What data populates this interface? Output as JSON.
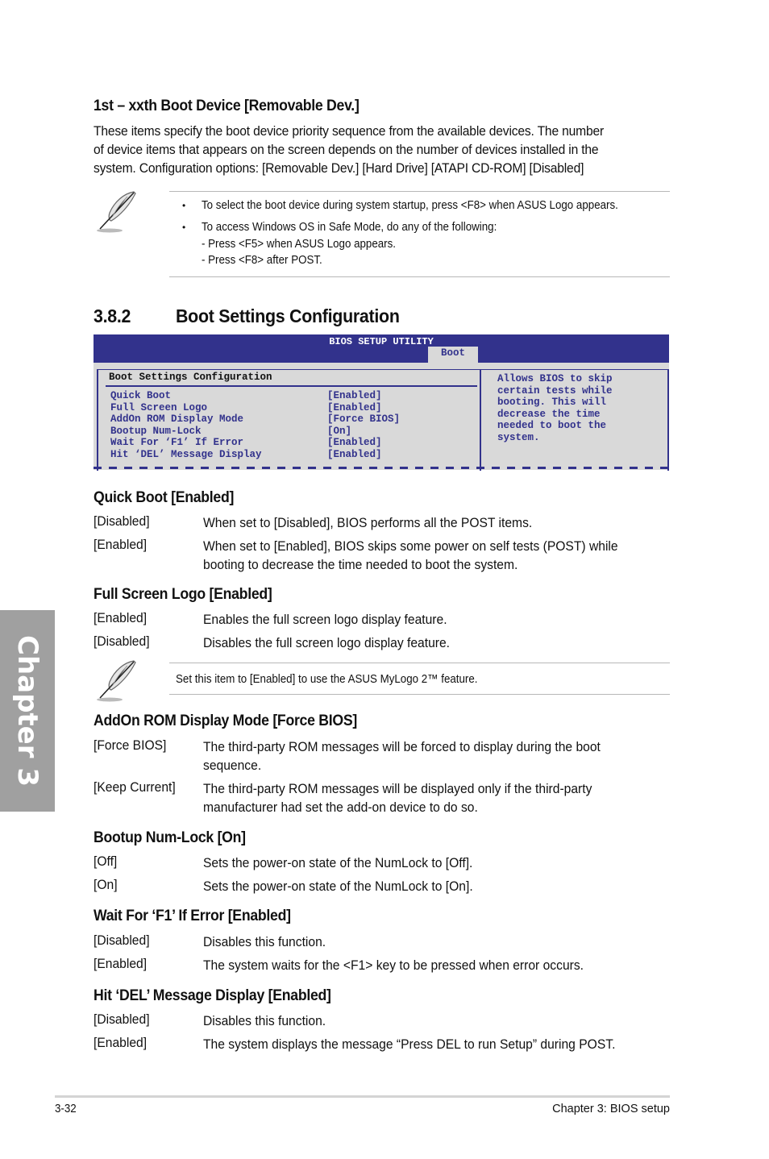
{
  "section_boot_device": {
    "heading": "1st – xxth Boot Device [Removable Dev.]",
    "para_lines": [
      "These items specify the boot device priority sequence from the available devices. The number",
      "of device items that appears on the screen depends on the number of devices installed in the",
      "system. Configuration options: [Removable Dev.] [Hard Drive] [ATAPI CD-ROM] [Disabled]"
    ]
  },
  "note1": {
    "icon": "feather-pen-icon",
    "bullets": [
      "To select the boot device during system startup, press <F8> when ASUS Logo appears.",
      "To access Windows OS in Safe Mode, do any of the following:"
    ],
    "sub_lines": [
      "- Press <F5> when ASUS Logo appears.",
      "- Press <F8> after POST."
    ],
    "bullet_char": "•"
  },
  "section_382": {
    "number": "3.8.2",
    "title": "Boot Settings Configuration"
  },
  "bios": {
    "title": "BIOS SETUP UTILITY",
    "active_tab": "Boot",
    "panel_title": "Boot Settings Configuration",
    "items": [
      {
        "label": "Quick Boot",
        "value": "[Enabled]"
      },
      {
        "label": "Full Screen Logo",
        "value": "[Enabled]"
      },
      {
        "label": "AddOn ROM Display Mode",
        "value": "[Force BIOS]"
      },
      {
        "label": "Bootup Num-Lock",
        "value": "[On]"
      },
      {
        "label": "Wait For ‘F1’ If Error",
        "value": "[Enabled]"
      },
      {
        "label": "Hit ‘DEL’ Message Display",
        "value": "[Enabled]"
      }
    ],
    "help_lines": [
      "Allows BIOS to skip",
      "certain tests while",
      "booting. This will",
      "decrease the time",
      "needed to boot the",
      "system."
    ],
    "colors": {
      "header_bg": "#32328c",
      "panel_bg": "#d9d9d9",
      "text": "#32328c"
    }
  },
  "quick_boot": {
    "heading": "Quick Boot [Enabled]",
    "options": [
      {
        "key": "[Disabled]",
        "desc": [
          "When set to [Disabled], BIOS performs all the POST items."
        ]
      },
      {
        "key": "[Enabled]",
        "desc": [
          "When set to [Enabled], BIOS skips some power on self tests (POST) while",
          "booting to decrease the time needed to boot the system."
        ]
      }
    ]
  },
  "full_screen_logo": {
    "heading": "Full Screen Logo [Enabled]",
    "options": [
      {
        "key": "[Enabled]",
        "desc": [
          "Enables the full screen logo display feature."
        ]
      },
      {
        "key": "[Disabled]",
        "desc": [
          "Disables the full screen logo display feature."
        ]
      }
    ]
  },
  "note2": {
    "icon": "feather-pen-icon",
    "text": "Set this item to [Enabled] to use the ASUS MyLogo 2™ feature."
  },
  "addon_rom": {
    "heading": "AddOn ROM Display Mode [Force BIOS]",
    "options": [
      {
        "key": "[Force BIOS]",
        "desc": [
          "The third-party ROM messages will be forced to display during the boot",
          "sequence."
        ]
      },
      {
        "key": "[Keep Current]",
        "desc": [
          "The third-party ROM messages will be displayed only if the third-party",
          "manufacturer had set the add-on device to do so."
        ]
      }
    ]
  },
  "numlock": {
    "heading": "Bootup Num-Lock [On]",
    "options": [
      {
        "key": "[Off]",
        "desc": [
          "Sets the power-on state of the NumLock to [Off]."
        ]
      },
      {
        "key": "[On]",
        "desc": [
          "Sets the power-on state of the NumLock to [On]."
        ]
      }
    ]
  },
  "wait_f1": {
    "heading": "Wait For ‘F1’ If Error [Enabled]",
    "options": [
      {
        "key": "[Disabled]",
        "desc": [
          "Disables this function."
        ]
      },
      {
        "key": "[Enabled]",
        "desc": [
          "The system waits for the <F1> key to be pressed when error occurs."
        ]
      }
    ]
  },
  "hit_del": {
    "heading": "Hit ‘DEL’ Message Display [Enabled]",
    "options": [
      {
        "key": "[Disabled]",
        "desc": [
          "Disables this function."
        ]
      },
      {
        "key": "[Enabled]",
        "desc": [
          "The system displays the message “Press DEL to run Setup” during POST."
        ]
      }
    ]
  },
  "side_tab": {
    "label": "Chapter 3",
    "color": "#a0a0a0"
  },
  "footer": {
    "page_number": "3-32",
    "chapter_label": "Chapter 3: BIOS setup"
  }
}
